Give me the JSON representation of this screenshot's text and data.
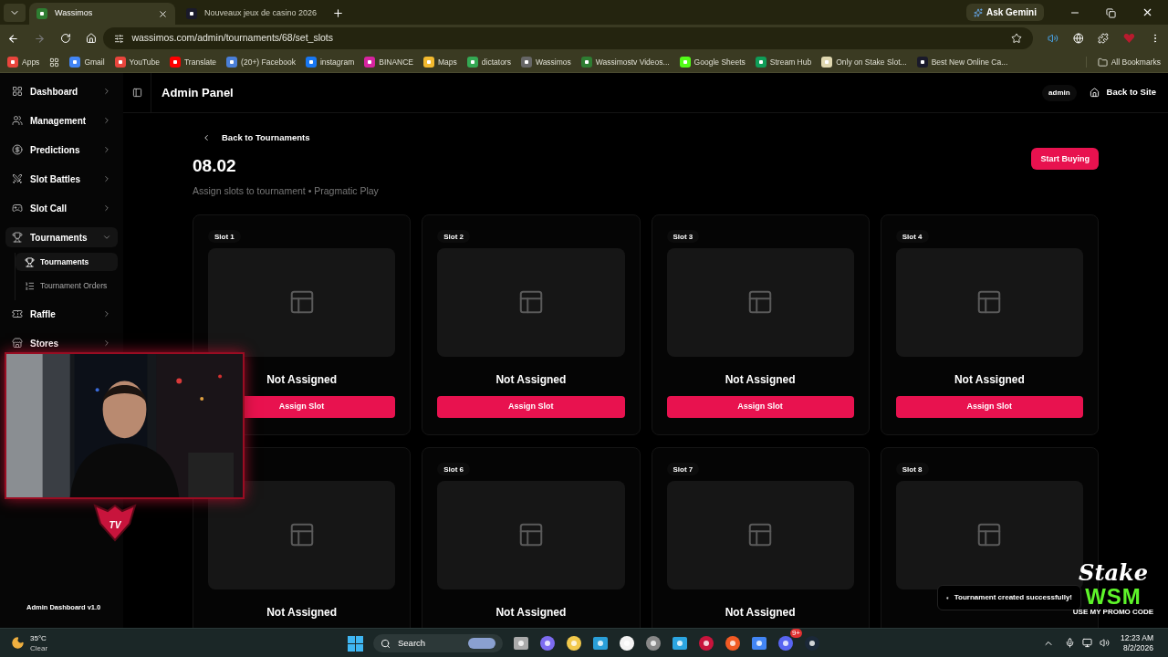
{
  "browser": {
    "tabs": [
      {
        "title": "Wassimos",
        "selected": true
      },
      {
        "title": "Nouveaux jeux de casino 2026",
        "selected": false
      }
    ],
    "ask_gemini": "Ask Gemini",
    "url": "wassimos.com/admin/tournaments/68/set_slots",
    "bookmarks": [
      "Apps",
      "Gmail",
      "YouTube",
      "Translate",
      "(20+) Facebook",
      "instagram",
      "BINANCE",
      "Maps",
      "dictators",
      "Wassimos",
      "Wassimostv Videos...",
      "Google Sheets",
      "Stream Hub",
      "Only on Stake Slot...",
      "Best New Online Ca..."
    ],
    "all_bookmarks": "All Bookmarks"
  },
  "sidebar": {
    "items": [
      {
        "label": "Dashboard",
        "selected": false,
        "expanded": false
      },
      {
        "label": "Management",
        "selected": false,
        "expanded": false
      },
      {
        "label": "Predictions",
        "selected": false,
        "expanded": false
      },
      {
        "label": "Slot Battles",
        "selected": false,
        "expanded": false
      },
      {
        "label": "Slot Call",
        "selected": false,
        "expanded": false
      },
      {
        "label": "Tournaments",
        "selected": true,
        "expanded": true,
        "children": [
          {
            "label": "Tournaments",
            "selected": true
          },
          {
            "label": "Tournament Orders",
            "selected": false
          }
        ]
      },
      {
        "label": "Raffle",
        "selected": false,
        "expanded": false
      },
      {
        "label": "Stores",
        "selected": false,
        "expanded": false
      }
    ],
    "footer": "Admin Dashboard v1.0"
  },
  "header": {
    "title": "Admin Panel",
    "user": "admin",
    "back_to_site": "Back to Site"
  },
  "content": {
    "back_link": "Back to Tournaments",
    "title": "08.02",
    "subtitle": "Assign slots to tournament • Pragmatic Play",
    "start_button": "Start Buying",
    "slots": [
      {
        "label": "Slot 1",
        "status": "Not Assigned",
        "button": "Assign Slot"
      },
      {
        "label": "Slot 2",
        "status": "Not Assigned",
        "button": "Assign Slot"
      },
      {
        "label": "Slot 3",
        "status": "Not Assigned",
        "button": "Assign Slot"
      },
      {
        "label": "Slot 4",
        "status": "Not Assigned",
        "button": "Assign Slot"
      },
      {
        "status": "Not Assigned"
      },
      {
        "label": "Slot 6",
        "status": "Not Assigned"
      },
      {
        "label": "Slot 7",
        "status": "Not Assigned"
      },
      {
        "label": "Slot 8"
      }
    ]
  },
  "toast": "Tournament created successfully!",
  "overlay": {
    "logo_text": "TV",
    "promo_brand": "Stake",
    "promo_code": "WSM",
    "promo_caption": "USE MY PROMO CODE"
  },
  "taskbar": {
    "temperature": "35°C",
    "condition": "Clear",
    "search": "Search",
    "discord_badge": "9+",
    "time": "12:23 AM",
    "date": "8/2/2026"
  }
}
